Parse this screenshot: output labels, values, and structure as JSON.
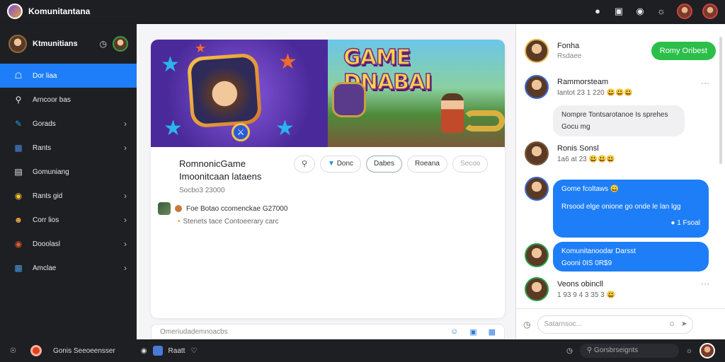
{
  "topbar": {
    "title": "Komunitantana"
  },
  "sidebar": {
    "profile_name": "Ktmunitians",
    "items": [
      {
        "label": "Dor liaa",
        "icon": "home-icon"
      },
      {
        "label": "Arncoor bas",
        "icon": "search-icon"
      },
      {
        "label": "Gorads",
        "icon": "pencil-icon"
      },
      {
        "label": "Rants",
        "icon": "book-icon"
      },
      {
        "label": "Gomuniang",
        "icon": "calendar-icon"
      },
      {
        "label": "Rants gid",
        "icon": "coin-icon"
      },
      {
        "label": "Corr lios",
        "icon": "users-icon"
      },
      {
        "label": "Dooolasl",
        "icon": "record-icon"
      },
      {
        "label": "Amclae",
        "icon": "apps-icon"
      }
    ]
  },
  "banner": {
    "game_title": "GAME DNABAI"
  },
  "post": {
    "title_line1": "RomnonicGame",
    "title_line2": "Imoonitcaan lataens",
    "subtitle": "Socbo3 23000",
    "actions": {
      "share_label": "Donc",
      "primary_label": "Dabes",
      "secondary_label": "Roeana",
      "tertiary_label": "Secoo"
    },
    "meta_line": "Foe  Botao  ccomenckae G27000",
    "meta_line2": "Stenets tace   Contoeerary carc"
  },
  "composer": {
    "placeholder": "Omeriudademnoacbs"
  },
  "chat": {
    "header": {
      "name": "Fonha",
      "sub": "Rsdaee",
      "follow_label": "Romy Oribest"
    },
    "messages": [
      {
        "name": "Rammorsteam",
        "meta": "Iantot 23 1 220"
      },
      {
        "name": "Ronis Sonsl",
        "meta": "1a6 at 23"
      },
      {
        "name": "Veons obincll",
        "meta": "1 93 9 4 3 35 3"
      }
    ],
    "bubbles": {
      "gray_line1": "Nompre Tontsarotanoe Is sprehes",
      "gray_line2": "Gocu mg",
      "blue1_line1": "Gome fcoltaws",
      "blue1_line2": "Rrsood elge onione go onde le lan lgg",
      "blue1_line3": "1 Fsoal",
      "blue2_line1": "Komunitanoodar Darsst",
      "blue2_line2": "Gooni 0IS 0R$9"
    },
    "input_placeholder": "Satarnsoc..."
  },
  "bottombar": {
    "status": "Gonis Seeoeensser",
    "game": "Raatt",
    "search_placeholder": "Gorsbrseignts"
  }
}
